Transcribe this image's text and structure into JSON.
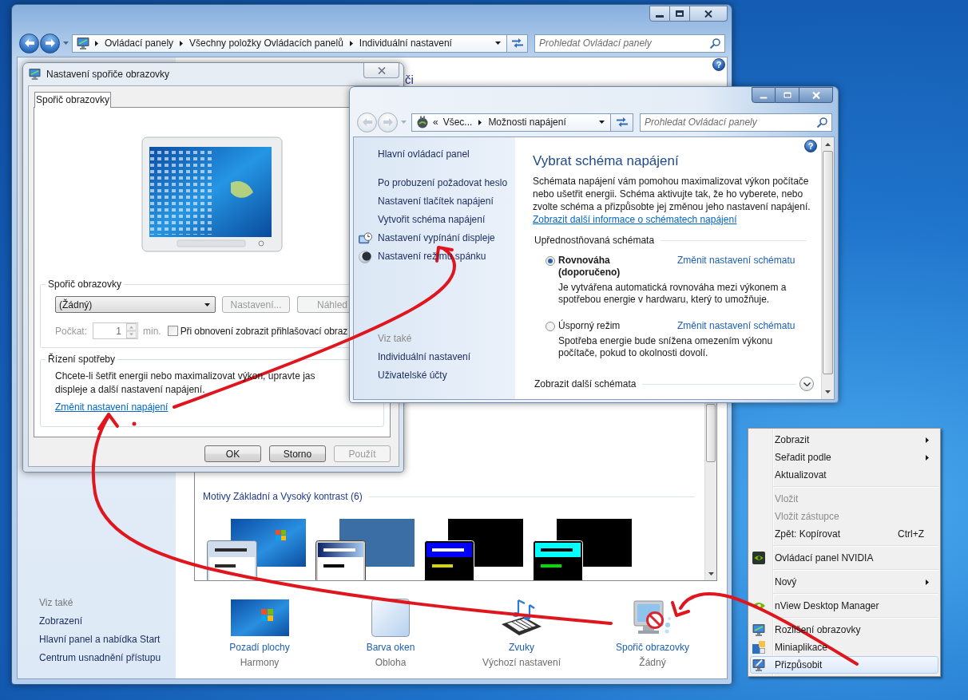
{
  "main_window": {
    "navigation": {
      "back_disabled": false,
      "forward_disabled": false
    },
    "breadcrumbs": [
      "Ovládací panely",
      "Všechny položky Ovládacích panelů",
      "Individuální nastavení"
    ],
    "search": {
      "placeholder": "Prohledat Ovládací panely"
    },
    "help": "?",
    "heading_fragment": "či",
    "see_also_title": "Viz také",
    "see_also": [
      "Zobrazení",
      "Hlavní panel a nabídka Start",
      "Centrum usnadnění přístupu"
    ],
    "theme_group": {
      "title": "Motivy Základní a Vysoký kontrast (6)",
      "themes": [
        {
          "kind": "basic"
        },
        {
          "kind": "classic"
        },
        {
          "kind": "contrast1"
        },
        {
          "kind": "contrast2"
        }
      ]
    },
    "settings": [
      {
        "kind": "wallpaper",
        "label": "Pozadí plochy",
        "value": "Harmony"
      },
      {
        "kind": "color",
        "label": "Barva oken",
        "value": "Obloha"
      },
      {
        "kind": "sounds",
        "label": "Zvuky",
        "value": "Výchozí nastavení"
      },
      {
        "kind": "screensaver",
        "label": "Spořič obrazovky",
        "value": "Žádný"
      }
    ]
  },
  "screensaver_dialog": {
    "title": "Nastavení spořiče obrazovky",
    "tabs": [
      {
        "label": "Spořič obrazovky",
        "selected": true
      }
    ],
    "screensaver_group": {
      "title": "Spořič obrazovky",
      "dropdown": {
        "value": "(Žádný)"
      },
      "buttons": [
        {
          "label": "Nastavení...",
          "disabled": true
        },
        {
          "label": "Náhled",
          "disabled": true
        }
      ],
      "wait": {
        "label": "Počkat:",
        "value": "1",
        "unit": "min.",
        "disabled": true
      },
      "logon_checkbox": {
        "label": "Při obnovení zobrazit přihlašovací obraz",
        "checked": false
      }
    },
    "power_group": {
      "title": "Řízení spotřeby",
      "text": "Chcete-li šetřit energii nebo maximalizovat výkon, upravte jas displeje a další nastavení napájení.",
      "link": "Změnit nastavení napájení"
    },
    "buttons": [
      {
        "label": "OK",
        "disabled": false
      },
      {
        "label": "Storno",
        "disabled": false
      },
      {
        "label": "Použít",
        "disabled": true
      }
    ]
  },
  "power_window": {
    "navigation": {
      "back_disabled": true,
      "forward_disabled": true
    },
    "breadcrumb_overflow": "«",
    "breadcrumbs": [
      "Všec...",
      "Možnosti napájení"
    ],
    "search": {
      "placeholder": "Prohledat Ovládací panely"
    },
    "help": "?",
    "sidebar": {
      "home": "Hlavní ovládací panel",
      "tasks": [
        {
          "kind": "plain",
          "label": "Po probuzení požadovat heslo"
        },
        {
          "kind": "plain",
          "label": "Nastavení tlačítek napájení"
        },
        {
          "kind": "plain",
          "label": "Vytvořit schéma napájení"
        },
        {
          "kind": "display",
          "label": "Nastavení vypínání displeje"
        },
        {
          "kind": "sleep",
          "label": "Nastavení režimu spánku"
        }
      ],
      "see_also_title": "Viz také",
      "see_also": [
        "Individuální nastavení",
        "Uživatelské účty"
      ]
    },
    "heading": "Vybrat schéma napájení",
    "intro": "Schémata napájení vám pomohou maximalizovat výkon počítače nebo ušetřit energii. Schéma aktivujte tak, že ho vyberete, nebo zvolte schéma a přizpůsobte jej změnou jeho nastavení napájení.",
    "info_link": "Zobrazit další informace o schématech napájení",
    "section_title": "Upřednostňovaná schémata",
    "plans": [
      {
        "name": "Rovnováha (doporučeno)",
        "selected": true,
        "link": "Změnit nastavení schématu",
        "description": "Je vytvářena automatická rovnováha mezi výkonem a spotřebou energie v hardwaru, který to umožňuje."
      },
      {
        "name": "Úsporný režim",
        "selected": false,
        "link": "Změnit nastavení schématu",
        "description": "Spotřeba energie bude snížena omezením výkonu počítače, pokud to okolnosti dovolí."
      }
    ],
    "more_plans": "Zobrazit další schémata"
  },
  "context_menu": {
    "items": [
      {
        "kind": "plain",
        "label": "Zobrazit",
        "submenu": true,
        "disabled": false,
        "selected": false
      },
      {
        "kind": "plain",
        "label": "Seřadit podle",
        "submenu": true,
        "disabled": false,
        "selected": false
      },
      {
        "kind": "plain",
        "label": "Aktualizovat",
        "submenu": false,
        "disabled": false,
        "selected": false
      },
      {
        "kind": "separator"
      },
      {
        "kind": "plain",
        "label": "Vložit",
        "submenu": false,
        "disabled": true,
        "selected": false
      },
      {
        "kind": "plain",
        "label": "Vložit zástupce",
        "submenu": false,
        "disabled": true,
        "selected": false
      },
      {
        "kind": "plain",
        "label": "Zpět: Kopírovat",
        "shortcut": "Ctrl+Z",
        "submenu": false,
        "disabled": false,
        "selected": false
      },
      {
        "kind": "separator"
      },
      {
        "kind": "nvidia",
        "label": "Ovládací panel NVIDIA",
        "submenu": false,
        "disabled": false,
        "selected": false
      },
      {
        "kind": "separator"
      },
      {
        "kind": "plain",
        "label": "Nový",
        "submenu": true,
        "disabled": false,
        "selected": false
      },
      {
        "kind": "separator"
      },
      {
        "kind": "nview",
        "label": "nView Desktop Manager",
        "submenu": false,
        "disabled": false,
        "selected": false
      },
      {
        "kind": "separator"
      },
      {
        "kind": "resolution",
        "label": "Rozlišení obrazovky",
        "submenu": false,
        "disabled": false,
        "selected": false
      },
      {
        "kind": "gadgets",
        "label": "Miniaplikace",
        "submenu": false,
        "disabled": false,
        "selected": false
      },
      {
        "kind": "personalize",
        "label": "Přizpůsobit",
        "submenu": false,
        "disabled": false,
        "selected": true
      }
    ]
  }
}
